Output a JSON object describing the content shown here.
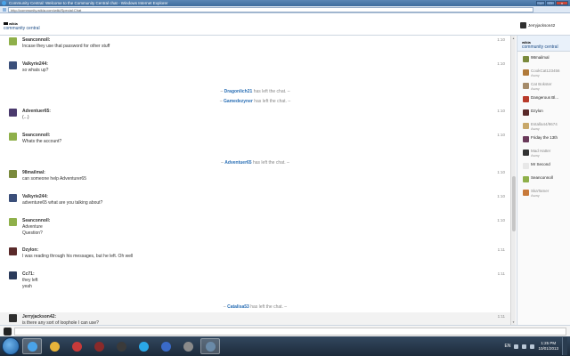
{
  "window": {
    "title": "Community Central: Welcome to the Community Central chat - Windows Internet Explorer",
    "url": "http://community.wikia.com/wiki/Special:Chat",
    "min_label": "–",
    "max_label": "□",
    "close_label": "x"
  },
  "header": {
    "logo_mark": "wikia",
    "wiki_name": "community central",
    "current_user": "Jerryjackson42"
  },
  "messages": [
    {
      "type": "msg",
      "user": "Seanconnoll:",
      "text": "Incase they use that password for other stuff",
      "time": "1:10",
      "avatar_color": "#8fb04a"
    },
    {
      "type": "msg",
      "user": "Valkyrie244:",
      "text": "so whats up?",
      "time": "1:10",
      "avatar_color": "#3b4f7a"
    },
    {
      "type": "notice",
      "user": "Dragonlich21",
      "text": "has left the chat."
    },
    {
      "type": "notice",
      "user": "Gamedezyner",
      "text": "has left the chat."
    },
    {
      "type": "msg",
      "user": "Adventuer65:",
      "text": "(...)",
      "time": "1:10",
      "avatar_color": "#4a3a6d"
    },
    {
      "type": "msg",
      "user": "Seanconnoll:",
      "text": "Whats the account?",
      "time": "1:10",
      "avatar_color": "#8fb04a"
    },
    {
      "type": "notice",
      "user": "Adventuer65",
      "text": "has left the chat."
    },
    {
      "type": "msg",
      "user": "98mailmal:",
      "text": "can someone help Adventurer65",
      "time": "1:10",
      "avatar_color": "#7a8a3c"
    },
    {
      "type": "msg",
      "user": "Valkyrie244:",
      "text": "adventure65 what are you talking about?",
      "time": "1:10",
      "avatar_color": "#3b4f7a"
    },
    {
      "type": "msg",
      "user": "Seanconnoll:",
      "text": "Adventure\nQuestion?",
      "time": "1:10",
      "avatar_color": "#8fb04a"
    },
    {
      "type": "msg",
      "user": "Dzylon:",
      "text": "I was reading through his messages, but he left. Oh well",
      "time": "1:11",
      "avatar_color": "#5a2a2a"
    },
    {
      "type": "msg",
      "user": "Cc71:",
      "text": "they left\nyeah",
      "time": "1:11",
      "avatar_color": "#2a3a5a"
    },
    {
      "type": "notice",
      "user": "Catalisa53",
      "text": "has left the chat."
    },
    {
      "type": "msg",
      "user": "Jerryjackson42:",
      "text": "is there any sort of loophole I can use?",
      "time": "1:11",
      "avatar_color": "#2f2f2f"
    }
  ],
  "sidebar": {
    "logo_mark": "wikia",
    "wiki_name": "community central",
    "users": [
      {
        "name": "98mailmal",
        "away": "",
        "color": "#7a8a3c"
      },
      {
        "name": "CookCat123456",
        "away": "Away",
        "color": "#b07a3a"
      },
      {
        "name": "Cat Bokster",
        "away": "Away",
        "color": "#a58b6a"
      },
      {
        "name": "Dangerous Bl...",
        "away": "",
        "color": "#b83a2a"
      },
      {
        "name": "Dzylon",
        "away": "",
        "color": "#5a2a2a"
      },
      {
        "name": "Estalla44/9674",
        "away": "Away",
        "color": "#c8a86a"
      },
      {
        "name": "Friday the 13th",
        "away": "",
        "color": "#6a3a5a"
      },
      {
        "name": "Mad Hatter",
        "away": "Away",
        "color": "#333333"
      },
      {
        "name": "Mr Second",
        "away": "",
        "color": "#e8e8e8"
      },
      {
        "name": "Seanconnoll",
        "away": "",
        "color": "#8fb04a"
      },
      {
        "name": "SkaTamer",
        "away": "Away",
        "color": "#c87a3a"
      }
    ]
  },
  "input": {
    "placeholder": ""
  },
  "taskbar": {
    "apps": [
      {
        "name": "internet-explorer",
        "color": "#4aa3e8",
        "active": true
      },
      {
        "name": "chrome",
        "color": "#e8b43a",
        "active": false
      },
      {
        "name": "media-player",
        "color": "#c83a3a",
        "active": false
      },
      {
        "name": "app-dark",
        "color": "#8a2a2a",
        "active": false
      },
      {
        "name": "terminal",
        "color": "#3a3a3a",
        "active": false
      },
      {
        "name": "skype",
        "color": "#2aa8e8",
        "active": false
      },
      {
        "name": "app-blue",
        "color": "#3a6ac8",
        "active": false
      },
      {
        "name": "app-grey",
        "color": "#8a8a8a",
        "active": false
      },
      {
        "name": "app-circle",
        "color": "#6a8aa8",
        "active": true
      }
    ],
    "language": "EN",
    "time": "1:25 PM",
    "date": "10/01/2013"
  }
}
